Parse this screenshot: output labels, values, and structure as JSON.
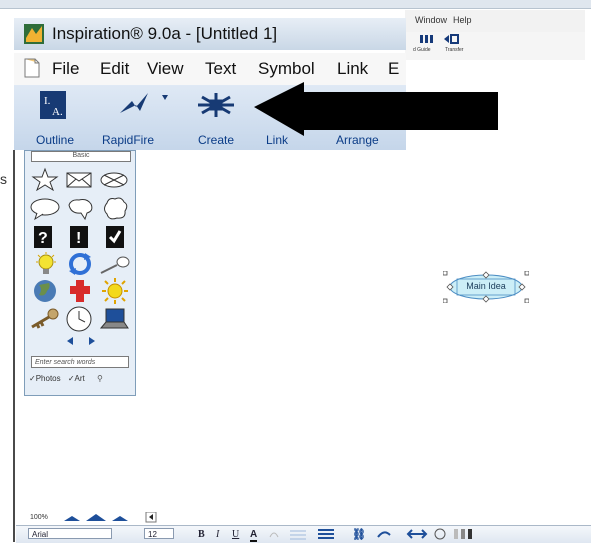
{
  "background_window": {
    "menu": [
      "Window",
      "Help"
    ],
    "toolbar": [
      "d Guide",
      "Transfer"
    ]
  },
  "window": {
    "title": "Inspiration® 9.0a - [Untitled 1]"
  },
  "menu": [
    "File",
    "Edit",
    "View",
    "Text",
    "Symbol",
    "Link",
    "E"
  ],
  "toolbar": {
    "outline": "Outline",
    "rapidfire": "RapidFire",
    "create": "Create",
    "link": "Link",
    "arrange": "Arrange"
  },
  "side_letter": "s",
  "palette": {
    "library": "Basic",
    "search_placeholder": "Enter search words",
    "photos": "✓Photos",
    "art": "✓Art"
  },
  "diagram": {
    "node_label": "Main Idea"
  },
  "status": {
    "zoom": "100%"
  },
  "format": {
    "font": "Arial",
    "size": "12",
    "bold": "B",
    "italic": "I",
    "underline": "U",
    "color": "A"
  }
}
